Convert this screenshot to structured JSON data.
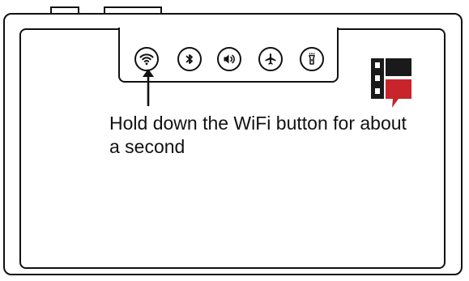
{
  "instruction": {
    "text": "Hold down the WiFi button for about a second"
  },
  "buttons": [
    {
      "icon": "wifi-icon"
    },
    {
      "icon": "bluetooth-icon"
    },
    {
      "icon": "volume-icon"
    },
    {
      "icon": "airplane-icon"
    },
    {
      "icon": "flashlight-icon"
    }
  ],
  "colors": {
    "outline": "#111111",
    "logo_dark": "#1a1a1a",
    "logo_red": "#c8242b",
    "background": "#ffffff"
  }
}
